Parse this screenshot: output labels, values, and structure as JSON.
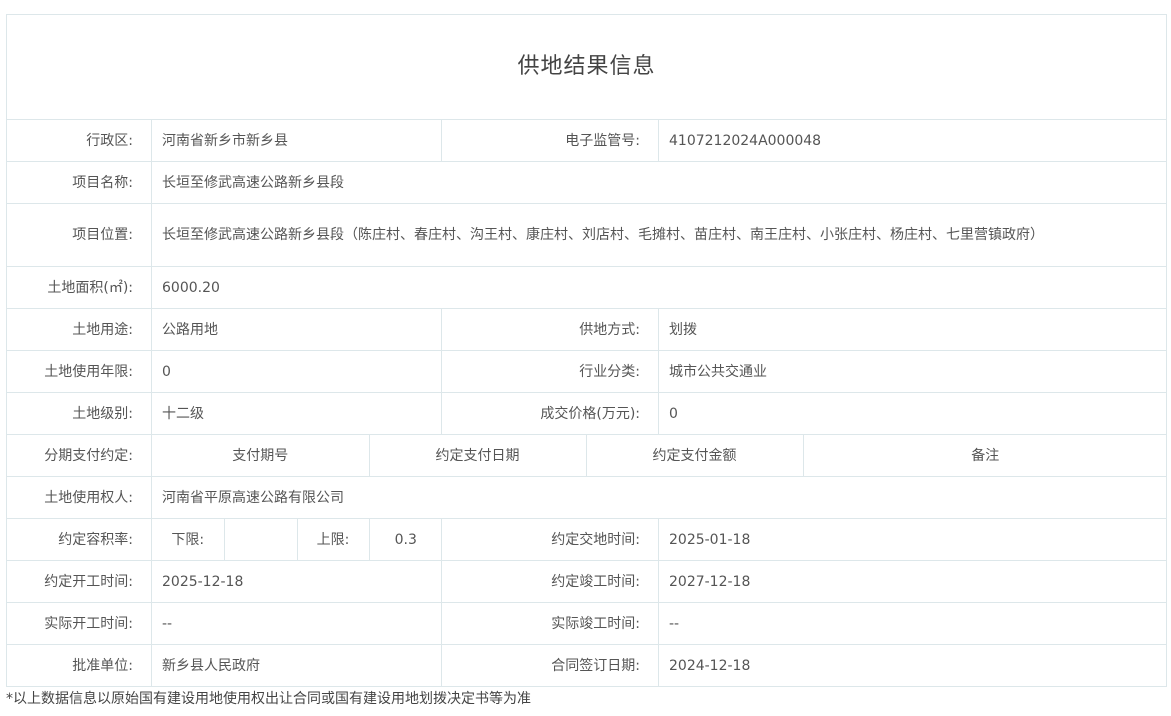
{
  "title": "供地结果信息",
  "fields": {
    "admin_region": {
      "label": "行政区:",
      "value": "河南省新乡市新乡县"
    },
    "supervision_no": {
      "label": "电子监管号:",
      "value": "4107212024A000048"
    },
    "project_name": {
      "label": "项目名称:",
      "value": "长垣至修武高速公路新乡县段"
    },
    "project_location": {
      "label": "项目位置:",
      "value": "长垣至修武高速公路新乡县段（陈庄村、春庄村、沟王村、康庄村、刘店村、毛摊村、苗庄村、南王庄村、小张庄村、杨庄村、七里营镇政府）"
    },
    "land_area": {
      "label": "土地面积(㎡):",
      "value": "6000.20"
    },
    "land_use": {
      "label": "土地用途:",
      "value": "公路用地"
    },
    "supply_method": {
      "label": "供地方式:",
      "value": "划拨"
    },
    "use_term": {
      "label": "土地使用年限:",
      "value": "0"
    },
    "industry": {
      "label": "行业分类:",
      "value": "城市公共交通业"
    },
    "land_grade": {
      "label": "土地级别:",
      "value": "十二级"
    },
    "price": {
      "label": "成交价格(万元):",
      "value": "0"
    },
    "installment": {
      "label": "分期支付约定:",
      "columns": [
        "支付期号",
        "约定支付日期",
        "约定支付金额",
        "备注"
      ]
    },
    "holder": {
      "label": "土地使用权人:",
      "value": "河南省平原高速公路有限公司"
    },
    "plot_ratio": {
      "label": "约定容积率:",
      "lower_label": "下限:",
      "lower_value": "",
      "upper_label": "上限:",
      "upper_value": "0.3"
    },
    "handover_time": {
      "label": "约定交地时间:",
      "value": "2025-01-18"
    },
    "start_time": {
      "label": "约定开工时间:",
      "value": "2025-12-18"
    },
    "finish_time": {
      "label": "约定竣工时间:",
      "value": "2027-12-18"
    },
    "actual_start": {
      "label": "实际开工时间:",
      "value": "--"
    },
    "actual_finish": {
      "label": "实际竣工时间:",
      "value": "--"
    },
    "approver": {
      "label": "批准单位:",
      "value": "新乡县人民政府"
    },
    "contract_date": {
      "label": "合同签订日期:",
      "value": "2024-12-18"
    }
  },
  "footnote": "*以上数据信息以原始国有建设用地使用权出让合同或国有建设用地划拨决定书等为准",
  "colors": {
    "border": "#dde7ea",
    "text": "#555555"
  }
}
